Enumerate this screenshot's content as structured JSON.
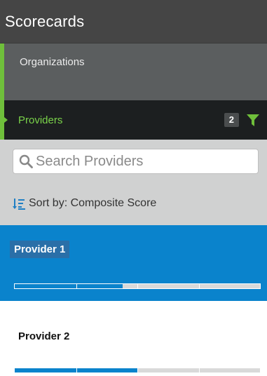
{
  "header": {
    "title": "Scorecards"
  },
  "nav": {
    "organizations_label": "Organizations",
    "providers_label": "Providers",
    "providers_filter_count": "2"
  },
  "search": {
    "placeholder": "Search Providers",
    "value": ""
  },
  "sort": {
    "label": "Sort by: Composite Score"
  },
  "providers": [
    {
      "name": "Provider 1",
      "selected": true,
      "score_fraction": 0.44
    },
    {
      "name": "Provider 2",
      "selected": false,
      "score_fraction": 0.5
    }
  ],
  "icons": {
    "filter": "filter-icon",
    "search": "search-icon",
    "sort": "sort-descending-icon"
  },
  "colors": {
    "accent_green": "#6fbf3b",
    "providers_text": "#7ad34a",
    "selected_blue": "#0a83cc",
    "header_bg": "#454545"
  }
}
